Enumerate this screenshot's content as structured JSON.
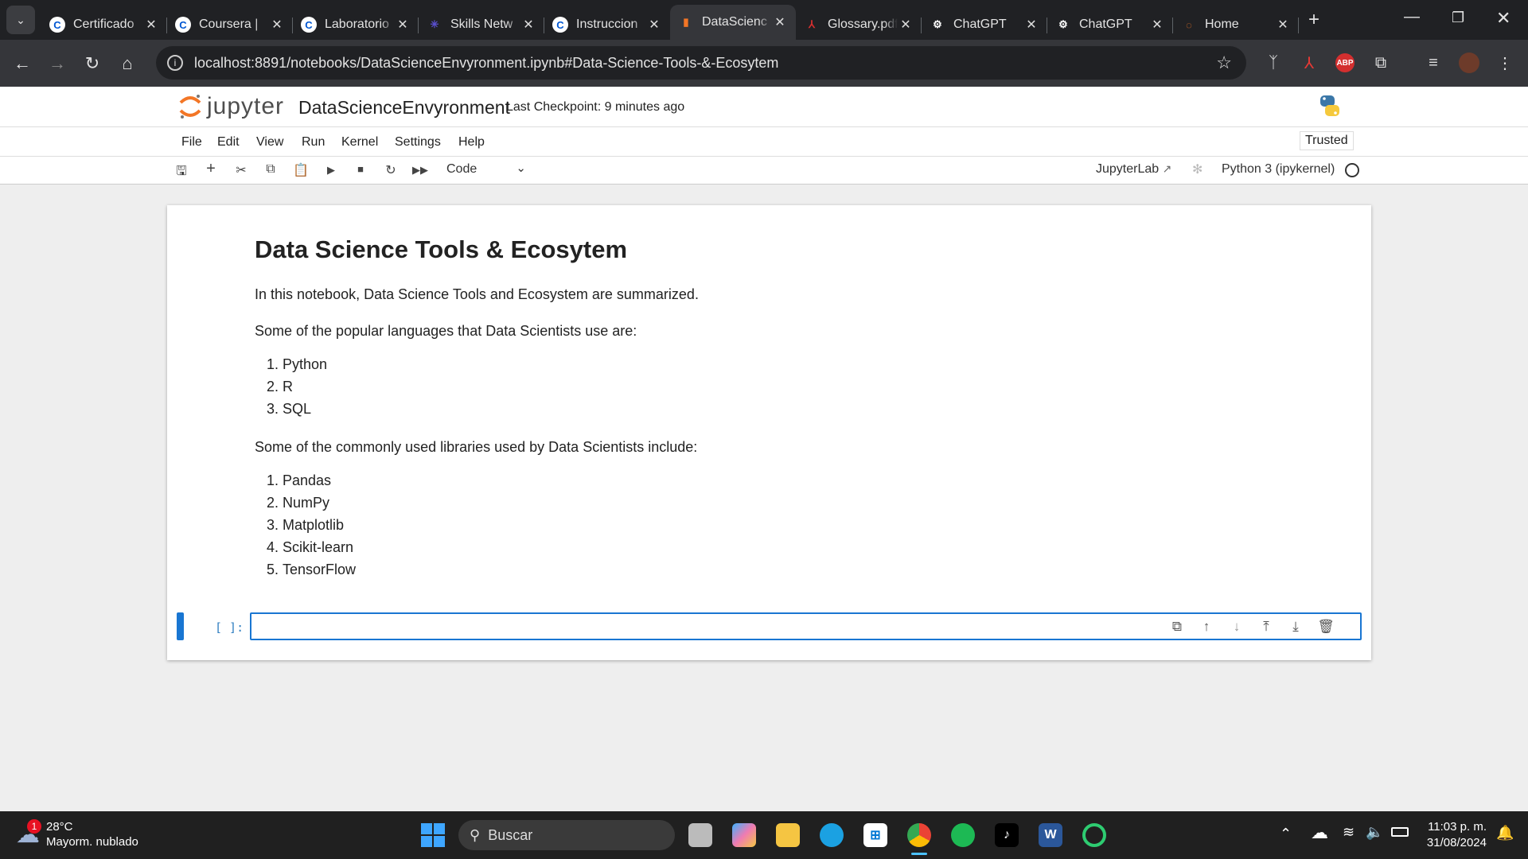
{
  "browser": {
    "tabs": [
      {
        "title": "Certificado",
        "icon": "coursera-icon",
        "color": "#0056d2",
        "glyph": "C"
      },
      {
        "title": "Coursera |",
        "icon": "coursera-icon",
        "color": "#0056d2",
        "glyph": "C"
      },
      {
        "title": "Laboratorio",
        "icon": "coursera-icon",
        "color": "#0056d2",
        "glyph": "C"
      },
      {
        "title": "Skills Netw",
        "icon": "skills-network-icon",
        "color": "#5a4fcf",
        "glyph": "✳"
      },
      {
        "title": "Instruccion",
        "icon": "coursera-icon",
        "color": "#0056d2",
        "glyph": "C"
      },
      {
        "title": "DataScienc",
        "icon": "notebook-icon",
        "color": "#f37626",
        "glyph": "▮"
      },
      {
        "title": "Glossary.pdf",
        "icon": "pdf-icon",
        "color": "#d32f2f",
        "glyph": "⅄"
      },
      {
        "title": "ChatGPT",
        "icon": "chatgpt-icon",
        "color": "#ffffff",
        "glyph": "⚙"
      },
      {
        "title": "ChatGPT",
        "icon": "chatgpt-icon",
        "color": "#ffffff",
        "glyph": "⚙"
      },
      {
        "title": "Home",
        "icon": "jupyter-icon",
        "color": "#f37626",
        "glyph": "◌"
      }
    ],
    "active_tab": 5,
    "url": "localhost:8891/notebooks/DataScienceEnvyronment.ipynb#Data-Science-Tools-&-Ecosytem"
  },
  "jupyter": {
    "logo_text": "jupyter",
    "notebook_name": "DataScienceEnvyronment",
    "checkpoint": "Last Checkpoint: 9 minutes ago",
    "trusted": "Trusted",
    "menu": [
      "File",
      "Edit",
      "View",
      "Run",
      "Kernel",
      "Settings",
      "Help"
    ],
    "cell_type": "Code",
    "jupyterlab_link": "JupyterLab",
    "kernel": "Python 3 (ipykernel)"
  },
  "notebook": {
    "title": "Data Science Tools & Ecosytem",
    "intro": "In this notebook, Data Science Tools and Ecosystem are summarized.",
    "languages_intro": "Some of the popular languages that Data Scientists use are:",
    "languages": [
      "Python",
      "R",
      "SQL"
    ],
    "libraries_intro": "Some of the commonly used libraries used by Data Scientists include:",
    "libraries": [
      "Pandas",
      "NumPy",
      "Matplotlib",
      "Scikit-learn",
      "TensorFlow"
    ],
    "prompt": "[ ]:"
  },
  "taskbar": {
    "weather_badge": "1",
    "temperature": "28°C",
    "weather": "Mayorm. nublado",
    "search_placeholder": "Buscar",
    "time": "11:03 p. m.",
    "date": "31/08/2024"
  }
}
